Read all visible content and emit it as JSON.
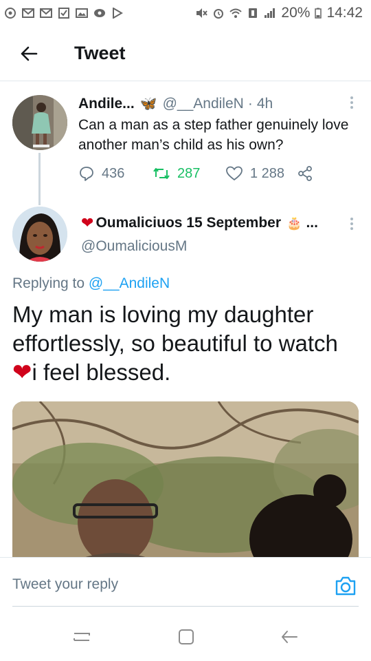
{
  "status_bar": {
    "battery_percent": "20%",
    "time": "14:42",
    "notification_icons": [
      "notification-dot-icon",
      "gmail-icon",
      "gmail-icon",
      "checkbox-icon",
      "gallery-icon",
      "location-icon",
      "play-store-icon"
    ],
    "system_icons": [
      "mute-icon",
      "alarm-icon",
      "wifi-icon",
      "sim-icon",
      "signal-icon",
      "battery-icon"
    ]
  },
  "header": {
    "title": "Tweet",
    "back_icon": "back-arrow-icon"
  },
  "original_tweet": {
    "name": "Andile...",
    "emoji": "🦋",
    "handle": "@__AndileN",
    "separator": "·",
    "time": "4h",
    "text": "Can a man as a step father genuinely love another man’s child as his own?",
    "replies": "436",
    "retweets": "287",
    "likes": "1 288",
    "accent_retweet": "#17bf63"
  },
  "reply_tweet": {
    "heart": "❤",
    "name": "Oumaliciuos 15 September",
    "emoji": "🎂",
    "ellipsis": "...",
    "handle": "@OumaliciousM",
    "replying_label": "Replying to",
    "replying_to": "@__AndileN",
    "text": "My man is loving my daughter effortlessly, so beautiful to watch",
    "text_heart": "❤",
    "text_end": "i feel blessed."
  },
  "reply_bar": {
    "placeholder": "Tweet your reply",
    "camera_icon": "camera-icon"
  },
  "nav_bar": {
    "recent_icon": "recent-apps-icon",
    "home_icon": "home-icon",
    "back_icon": "nav-back-icon"
  },
  "colors": {
    "link": "#1da1f2",
    "secondary_text": "#657786",
    "heart": "#d0021b"
  }
}
